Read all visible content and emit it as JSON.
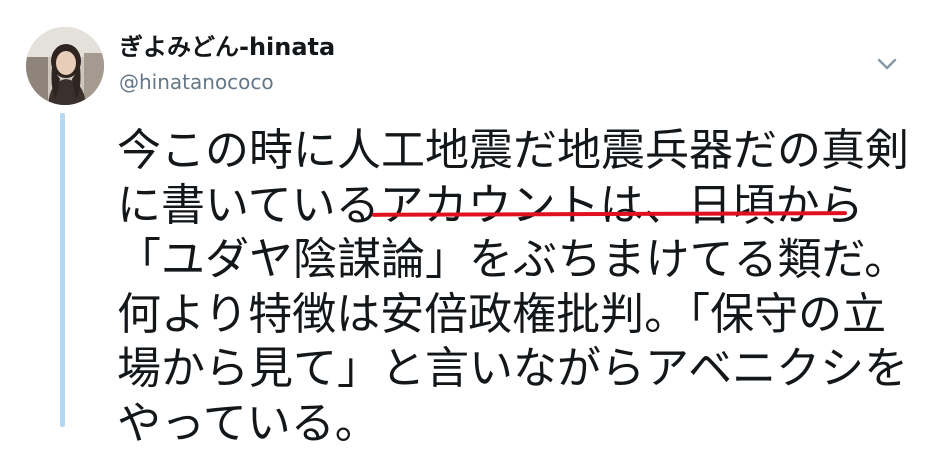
{
  "tweet": {
    "author": {
      "display_name": "ぎよみどん-hinata",
      "handle": "@hinatanococo"
    },
    "menu_icon": "chevron-down-icon",
    "text_lines": [
      "今この時に人工地震だ地震兵器だの真剣",
      "に書いているアカウントは、日頃から",
      "「ユダヤ陰謀論」をぶちまけてる類だ。",
      "何より特徴は安倍政権批判。「保守の立",
      "場から見て」と言いながらアベニクシを",
      "やっている。"
    ],
    "annotation_color": "#e01020",
    "thread_line_color": "#b8d7f0"
  }
}
